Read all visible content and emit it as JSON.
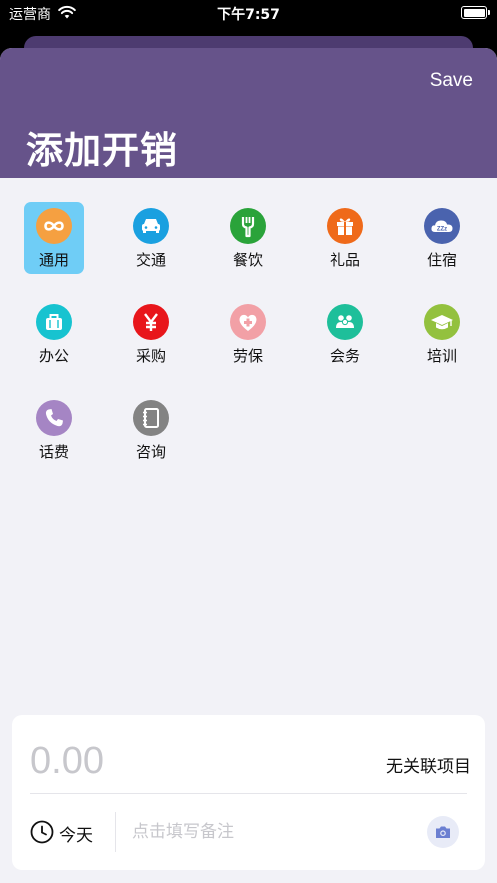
{
  "status_bar": {
    "carrier": "运营商",
    "time": "下午7:57"
  },
  "header": {
    "save_label": "Save",
    "title": "添加开销"
  },
  "categories": [
    {
      "label": "通用",
      "icon": "infinity-icon",
      "color": "#f5a041",
      "selected": true
    },
    {
      "label": "交通",
      "icon": "car-icon",
      "color": "#1aa0e0"
    },
    {
      "label": "餐饮",
      "icon": "fork-icon",
      "color": "#2aa33a"
    },
    {
      "label": "礼品",
      "icon": "gift-icon",
      "color": "#ef6a1a"
    },
    {
      "label": "住宿",
      "icon": "sleep-cloud-icon",
      "color": "#4a63ae"
    },
    {
      "label": "办公",
      "icon": "briefcase-icon",
      "color": "#17c3d0"
    },
    {
      "label": "采购",
      "icon": "yen-icon",
      "color": "#e8161b"
    },
    {
      "label": "劳保",
      "icon": "heart-medical-icon",
      "color": "#f2a0a6"
    },
    {
      "label": "会务",
      "icon": "people-icon",
      "color": "#1ebf9a"
    },
    {
      "label": "培训",
      "icon": "graduation-cap-icon",
      "color": "#93c13e"
    },
    {
      "label": "话费",
      "icon": "phone-icon",
      "color": "#a585c4"
    },
    {
      "label": "咨询",
      "icon": "notebook-icon",
      "color": "#838383"
    }
  ],
  "entry": {
    "amount": "0.00",
    "project": "无关联项目",
    "date_label": "今天",
    "note_placeholder": "点击填写备注",
    "camera_icon": "camera-icon"
  },
  "colors": {
    "header": "#66538a",
    "selected": "#6fcdf6",
    "background": "#f2f2f7"
  }
}
